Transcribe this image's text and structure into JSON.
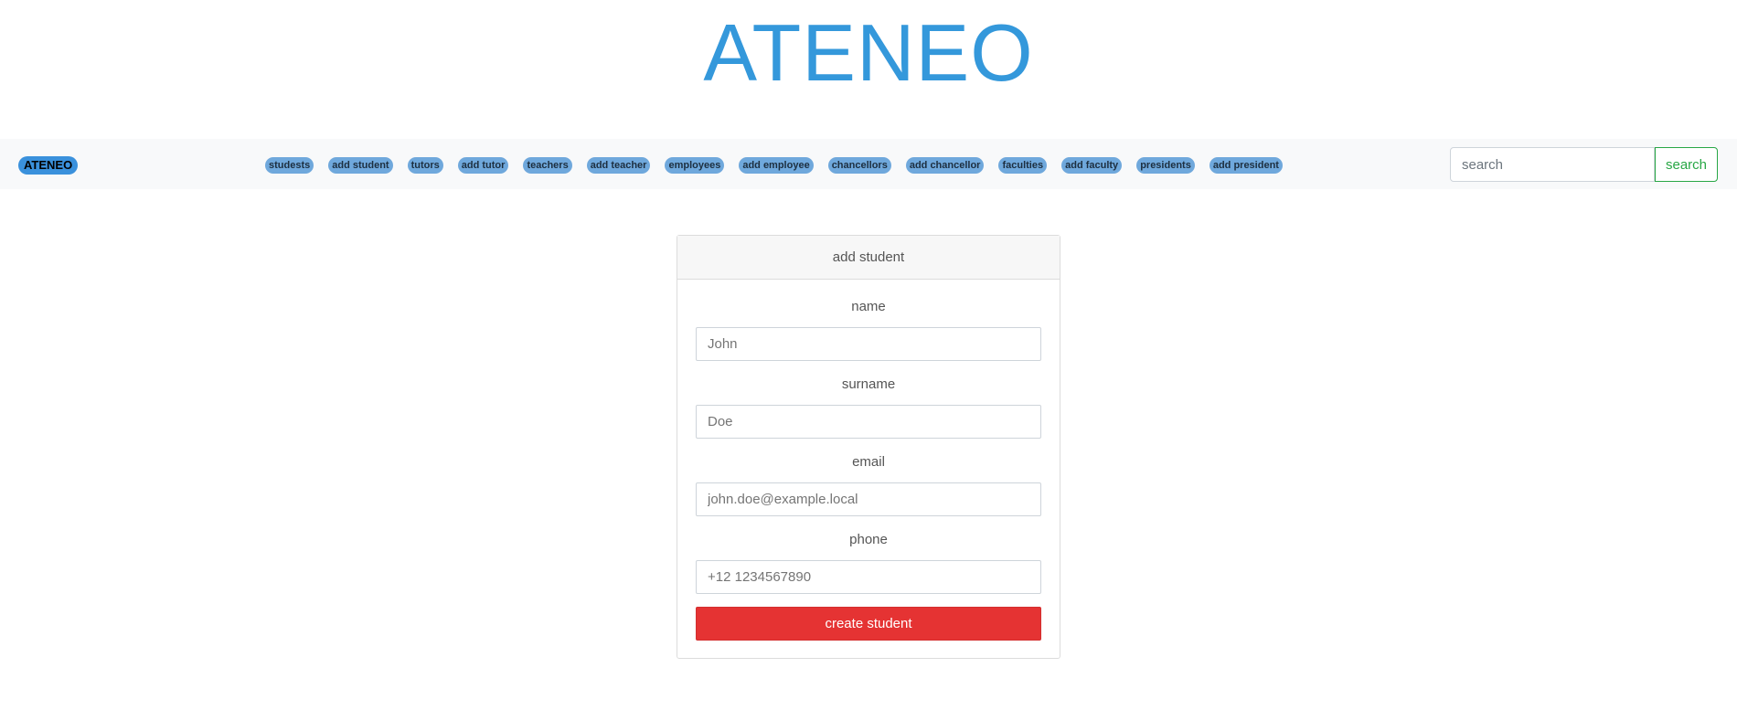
{
  "header": {
    "title": "ATENEO"
  },
  "navbar": {
    "brand": "ATENEO",
    "links": [
      "studests",
      "add student",
      "tutors",
      "add tutor",
      "teachers",
      "add teacher",
      "employees",
      "add employee",
      "chancellors",
      "add chancellor",
      "faculties",
      "add faculty",
      "presidents",
      "add president"
    ],
    "search": {
      "placeholder": "search",
      "value": "",
      "button_label": "search"
    }
  },
  "form": {
    "title": "add student",
    "fields": [
      {
        "label": "name",
        "placeholder": "John",
        "value": ""
      },
      {
        "label": "surname",
        "placeholder": "Doe",
        "value": ""
      },
      {
        "label": "email",
        "placeholder": "john.doe@example.local",
        "value": ""
      },
      {
        "label": "phone",
        "placeholder": "+12 1234567890",
        "value": ""
      }
    ],
    "submit_label": "create student"
  },
  "colors": {
    "title": "#3498db",
    "brand": "#3a91dc",
    "nav_pill": "#6fa8dc",
    "search_button": "#28a745",
    "submit": "#e53333"
  }
}
